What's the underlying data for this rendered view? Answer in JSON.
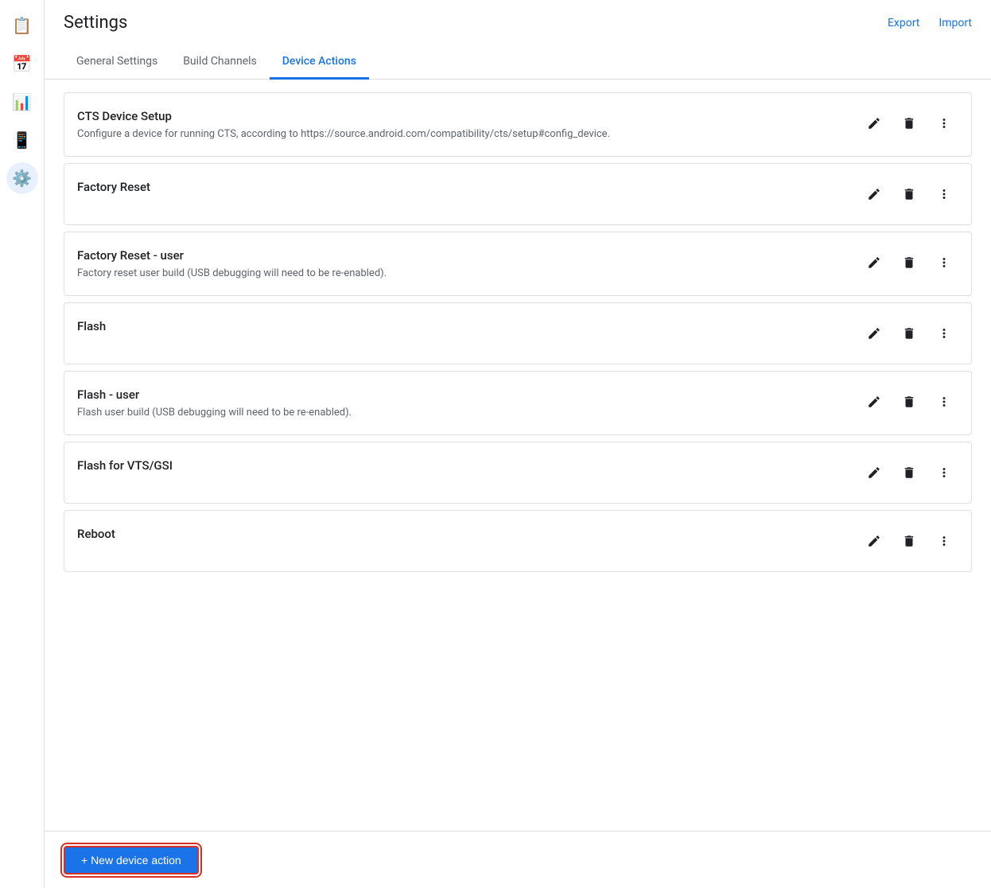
{
  "header": {
    "title": "Settings",
    "export_label": "Export",
    "import_label": "Import"
  },
  "tabs": [
    {
      "id": "general",
      "label": "General Settings",
      "active": false
    },
    {
      "id": "build-channels",
      "label": "Build Channels",
      "active": false
    },
    {
      "id": "device-actions",
      "label": "Device Actions",
      "active": true
    }
  ],
  "sidebar": {
    "items": [
      {
        "id": "reports",
        "icon": "📋",
        "active": false
      },
      {
        "id": "calendar",
        "icon": "📅",
        "active": false
      },
      {
        "id": "analytics",
        "icon": "📊",
        "active": false
      },
      {
        "id": "device",
        "icon": "📱",
        "active": false
      },
      {
        "id": "settings",
        "icon": "⚙️",
        "active": true
      }
    ]
  },
  "actions": [
    {
      "id": "cts-device-setup",
      "title": "CTS Device Setup",
      "description": "Configure a device for running CTS, according to https://source.android.com/compatibility/cts/setup#config_device."
    },
    {
      "id": "factory-reset",
      "title": "Factory Reset",
      "description": ""
    },
    {
      "id": "factory-reset-user",
      "title": "Factory Reset - user",
      "description": "Factory reset user build (USB debugging will need to be re-enabled)."
    },
    {
      "id": "flash",
      "title": "Flash",
      "description": ""
    },
    {
      "id": "flash-user",
      "title": "Flash - user",
      "description": "Flash user build (USB debugging will need to be re-enabled)."
    },
    {
      "id": "flash-vts-gsi",
      "title": "Flash for VTS/GSI",
      "description": ""
    },
    {
      "id": "reboot",
      "title": "Reboot",
      "description": ""
    }
  ],
  "bottom": {
    "new_action_label": "+ New device action"
  },
  "icons": {
    "pencil": "✏",
    "trash": "🗑",
    "more": "⋮"
  }
}
